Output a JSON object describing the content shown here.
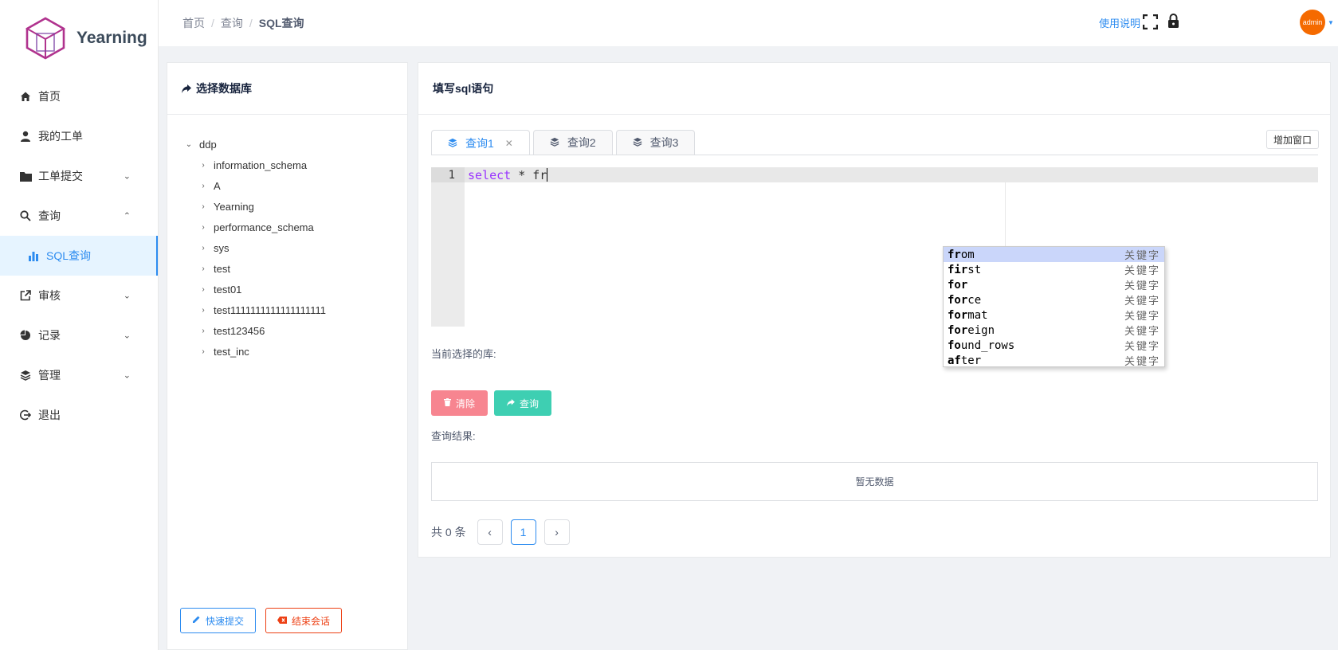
{
  "app": {
    "name": "Yearning"
  },
  "sidebar": {
    "items": [
      {
        "label": "首页",
        "icon": "home-icon"
      },
      {
        "label": "我的工单",
        "icon": "user-icon"
      },
      {
        "label": "工单提交",
        "icon": "folder-icon"
      },
      {
        "label": "查询",
        "icon": "search-icon"
      },
      {
        "label": "SQL查询",
        "icon": "bar-chart-icon"
      },
      {
        "label": "审核",
        "icon": "external-link-icon"
      },
      {
        "label": "记录",
        "icon": "pie-chart-icon"
      },
      {
        "label": "管理",
        "icon": "layers-icon"
      },
      {
        "label": "退出",
        "icon": "logout-icon"
      }
    ]
  },
  "header": {
    "breadcrumb": [
      "首页",
      "查询",
      "SQL查询"
    ],
    "help_link": "使用说明",
    "avatar_text": "admin"
  },
  "db_panel": {
    "title": "选择数据库",
    "root": "ddp",
    "databases": [
      "information_schema",
      "A",
      "Yearning",
      "performance_schema",
      "sys",
      "test",
      "test01",
      "test1111111111111111111",
      "test123456",
      "test_inc"
    ],
    "quick_submit": "快速提交",
    "end_session": "结束会话"
  },
  "sql_panel": {
    "title": "填写sql语句",
    "tabs": [
      "查询1",
      "查询2",
      "查询3"
    ],
    "add_tab": "增加窗口",
    "editor": {
      "line_number": "1",
      "keyword": "select",
      "rest": " * fr"
    },
    "autocomplete": [
      {
        "match": "fr",
        "rest": "om",
        "meta": "关键字"
      },
      {
        "match": "fir",
        "rest": "st",
        "meta": "关键字"
      },
      {
        "match": "for",
        "rest": "",
        "meta": "关键字"
      },
      {
        "match": "for",
        "rest": "ce",
        "meta": "关键字"
      },
      {
        "match": "for",
        "rest": "mat",
        "meta": "关键字"
      },
      {
        "match": "for",
        "rest": "eign",
        "meta": "关键字"
      },
      {
        "match": "fo",
        "rest": "und_rows",
        "meta": "关键字"
      },
      {
        "match": "af",
        "rest": "ter",
        "meta": "关键字"
      }
    ],
    "current_db_label": "当前选择的库:",
    "clear_button": "清除",
    "query_button": "查询",
    "result_label": "查询结果:",
    "empty_text": "暂无数据",
    "pager": {
      "total": "共 0 条",
      "page": "1"
    }
  }
}
